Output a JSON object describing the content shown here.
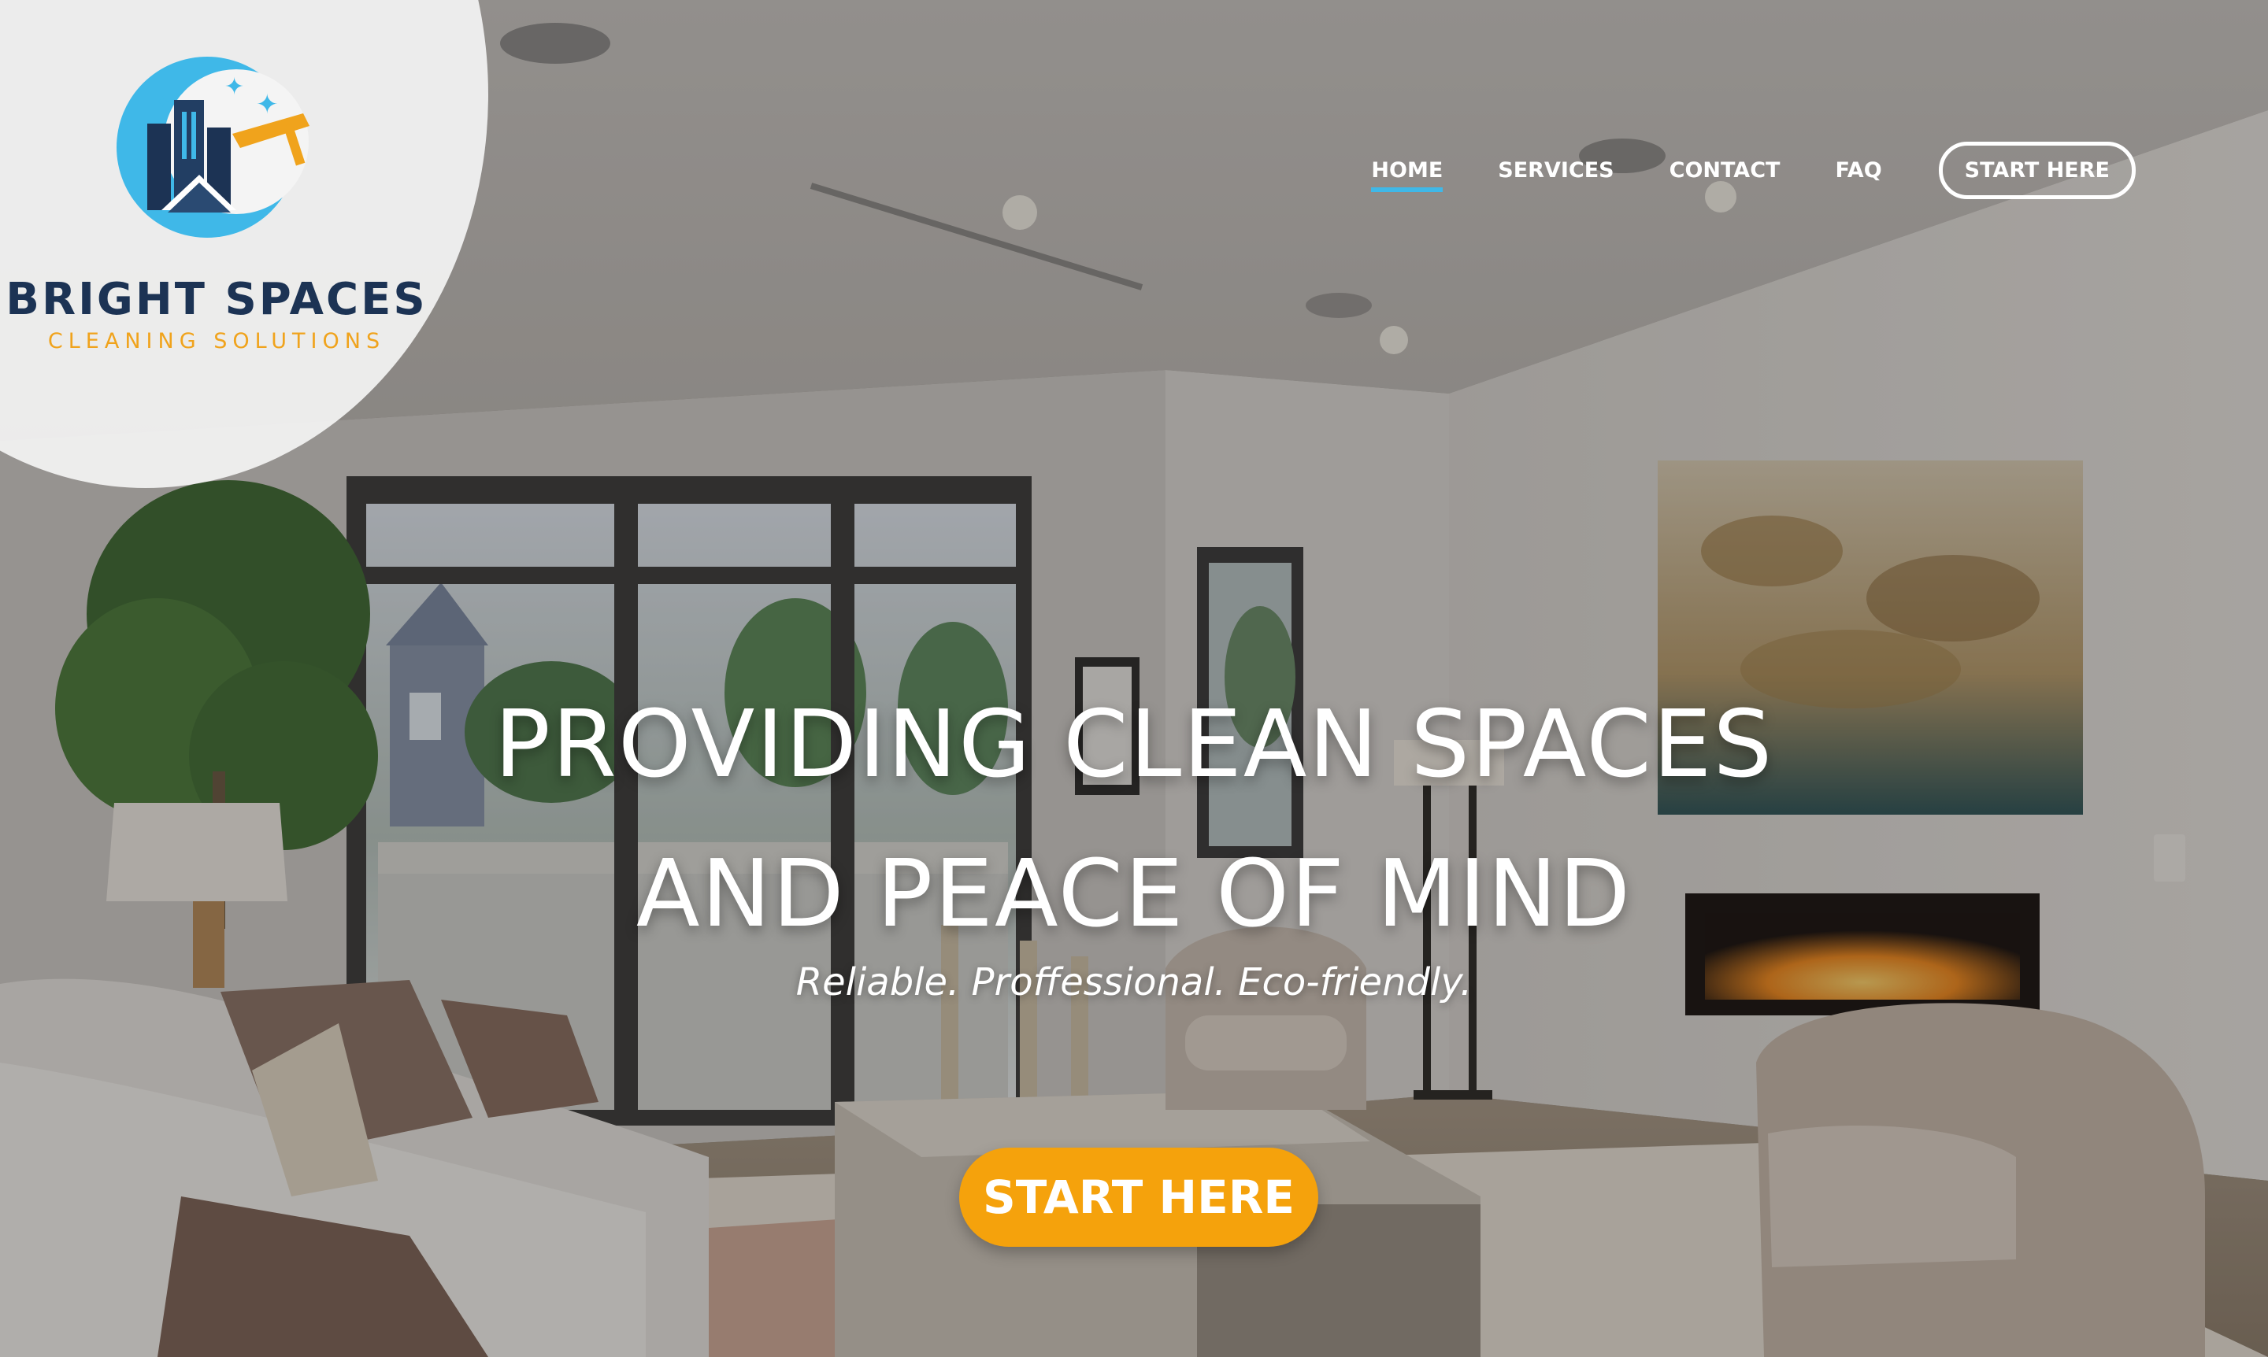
{
  "brand": {
    "name": "BRIGHT SPACES",
    "tagline": "CLEANING SOLUTIONS",
    "logo_icon": "city-buildings-squeegee-logo",
    "colors": {
      "navy": "#1c3354",
      "sky": "#3fb8e8",
      "orange": "#f0a31c"
    }
  },
  "nav": {
    "items": [
      {
        "label": "HOME",
        "active": true
      },
      {
        "label": "SERVICES",
        "active": false
      },
      {
        "label": "CONTACT",
        "active": false
      },
      {
        "label": "FAQ",
        "active": false
      }
    ],
    "cta_label": "START HERE",
    "active_underline_color": "#3fb8e8"
  },
  "hero": {
    "headline_line1": "PROVIDING CLEAN SPACES",
    "headline_line2": "AND PEACE OF MIND",
    "subheadline": "Reliable. Proffessional. Eco-friendly.",
    "cta_label": "START HERE",
    "cta_color": "#f5a20c",
    "background": "living-room-photo"
  }
}
